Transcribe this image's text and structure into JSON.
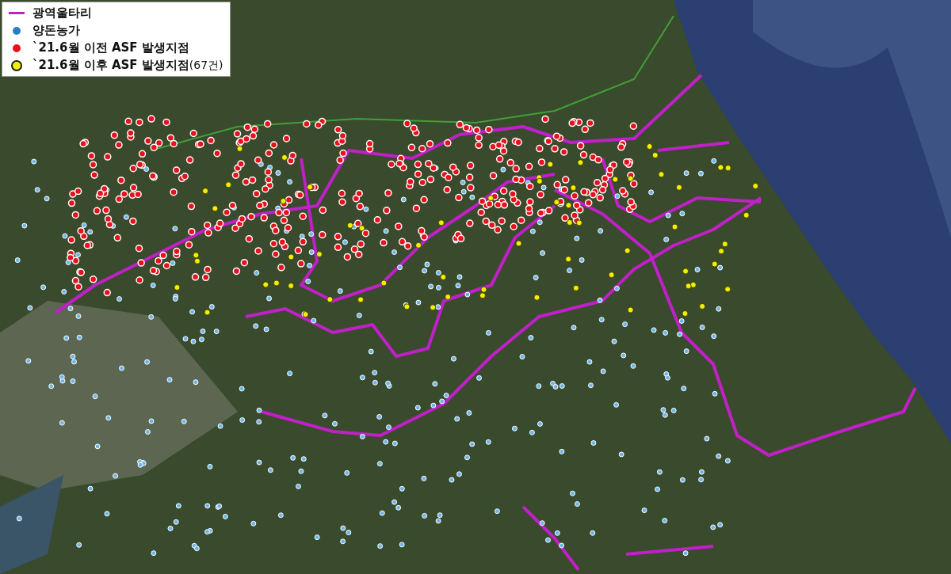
{
  "legend": {
    "items": [
      {
        "kind": "line",
        "color": "#c020c8",
        "label": "광역울타리"
      },
      {
        "kind": "dot",
        "color": "#2a7fc0",
        "label": "양돈농가"
      },
      {
        "kind": "dot",
        "color": "#e8101a",
        "label": "`21.6월 이전 ASF 발생지점"
      },
      {
        "kind": "ring",
        "color": "#f0f000",
        "label": "`21.6월 이후 ASF 발생지점",
        "note": "(67건)"
      }
    ]
  }
}
